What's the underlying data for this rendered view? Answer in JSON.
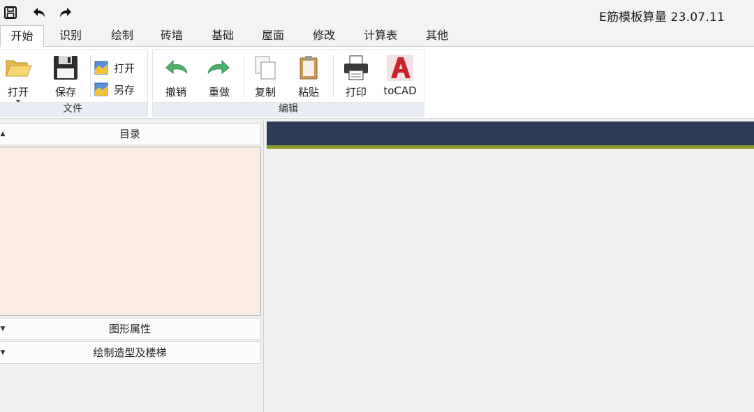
{
  "app": {
    "title": "E筋模板算量 23.07.11"
  },
  "quick_access": [
    "save-icon",
    "undo-icon",
    "redo-icon"
  ],
  "tabs": [
    {
      "label": "开始",
      "active": true
    },
    {
      "label": "识别"
    },
    {
      "label": "绘制"
    },
    {
      "label": "砖墙"
    },
    {
      "label": "基础"
    },
    {
      "label": "屋面"
    },
    {
      "label": "修改"
    },
    {
      "label": "计算表"
    },
    {
      "label": "其他"
    }
  ],
  "ribbon": {
    "file_group": {
      "label": "文件",
      "open": "打开",
      "save": "保存",
      "open_small": "打开",
      "save_as": "另存"
    },
    "edit_group": {
      "label": "编辑",
      "undo": "撤销",
      "redo": "重做",
      "copy": "复制",
      "paste": "粘贴",
      "print": "打印",
      "tocad": "toCAD"
    }
  },
  "left_panel": {
    "catalog": "目录",
    "graphic_props": "图形属性",
    "draw_shapes": "绘制造型及楼梯"
  },
  "colors": {
    "catalog_bg": "#fbede2",
    "canvas_band": "#2d3b56",
    "canvas_stripe": "#8a9a2e",
    "autocad_red": "#c8242b"
  }
}
